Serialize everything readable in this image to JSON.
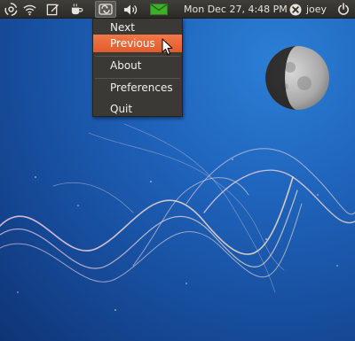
{
  "panel": {
    "icons": [
      "ubuntu-swirl-icon",
      "wifi-icon",
      "notes-icon",
      "coffee-icon",
      "media-player-icon",
      "volume-icon",
      "mail-icon",
      "user-switch-icon",
      "power-icon"
    ],
    "clock": "Mon Dec 27,  4:48 PM",
    "username": "joey",
    "mail_color": "#3fae2a"
  },
  "menu": {
    "items": [
      {
        "label": "Next"
      },
      {
        "label": "Previous"
      },
      {
        "label": "About"
      },
      {
        "label": "Preferences"
      },
      {
        "label": "Quit"
      }
    ],
    "highlight_color": "#e96b39"
  }
}
